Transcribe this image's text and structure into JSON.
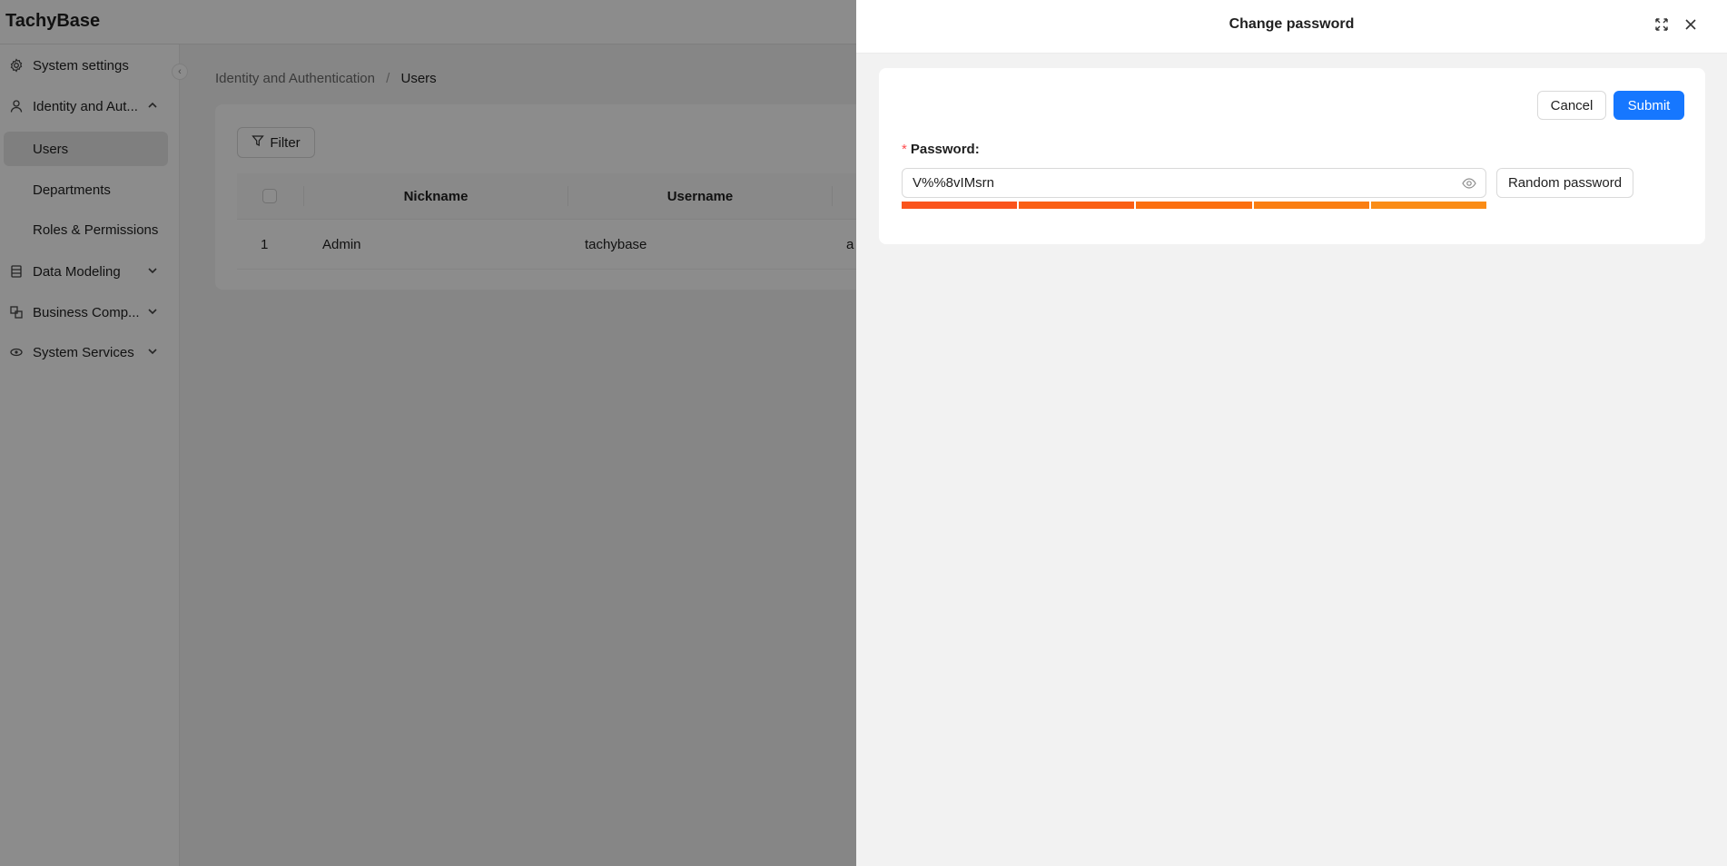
{
  "app": {
    "logo": "TachyBase"
  },
  "sidebar": {
    "items": [
      {
        "label": "System settings",
        "icon": "gear-icon",
        "expanded": null
      },
      {
        "label": "Identity and Aut...",
        "icon": "user-icon",
        "expanded": true
      },
      {
        "label": "Users",
        "sub": true,
        "active": true
      },
      {
        "label": "Departments",
        "sub": true
      },
      {
        "label": "Roles & Permissions",
        "sub": true
      },
      {
        "label": "Data Modeling",
        "icon": "database-icon",
        "expanded": false
      },
      {
        "label": "Business Comp...",
        "icon": "components-icon",
        "expanded": false
      },
      {
        "label": "System Services",
        "icon": "services-icon",
        "expanded": false
      }
    ]
  },
  "breadcrumb": {
    "parent": "Identity and Authentication",
    "separator": "/",
    "current": "Users"
  },
  "table": {
    "filter_label": "Filter",
    "columns": [
      "Nickname",
      "Username"
    ],
    "rows": [
      {
        "index": "1",
        "nickname": "Admin",
        "username": "tachybase",
        "extra": "a"
      }
    ]
  },
  "drawer": {
    "title": "Change password",
    "cancel_label": "Cancel",
    "submit_label": "Submit",
    "password_label": "Password",
    "password_label_colon": ":",
    "required_mark": "*",
    "password_value": "V%%8vIMsrn",
    "random_password_label": "Random password",
    "strength_segments": 5,
    "strength_colors": [
      "#fa541c",
      "#fa5f14",
      "#fb6f10",
      "#fa7e12",
      "#fa8c16"
    ]
  },
  "colors": {
    "primary": "#1677ff",
    "required": "#ff4d4f"
  }
}
